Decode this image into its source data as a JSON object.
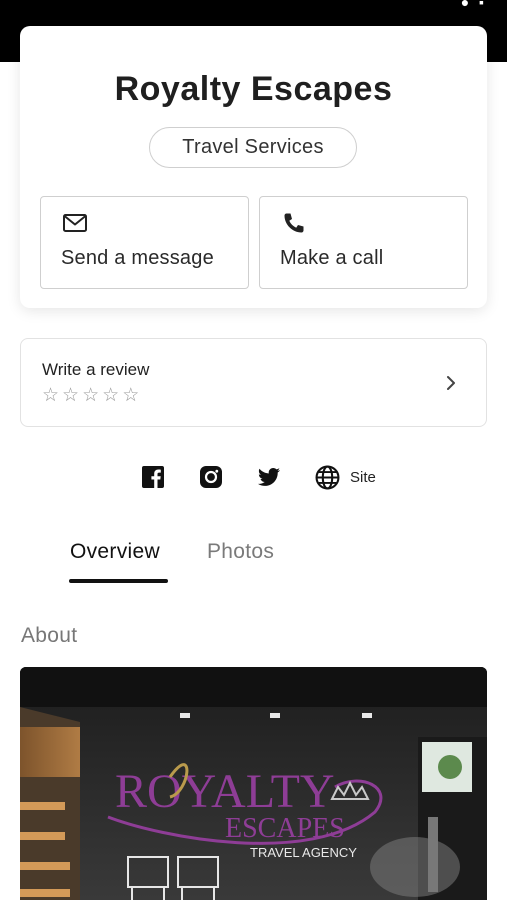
{
  "business": {
    "name": "Royalty Escapes",
    "category": "Travel Services"
  },
  "actions": {
    "message_label": "Send a message",
    "call_label": "Make a call"
  },
  "review": {
    "label": "Write a review",
    "stars": [
      "☆",
      "☆",
      "☆",
      "☆",
      "☆"
    ]
  },
  "social": {
    "site_label": "Site",
    "icons": [
      "facebook-icon",
      "instagram-icon",
      "twitter-icon",
      "globe-icon"
    ]
  },
  "tabs": {
    "overview": "Overview",
    "photos": "Photos",
    "active": "Overview"
  },
  "about": {
    "heading": "About",
    "image_logo_text": [
      "ROYALTY",
      "ESCAPES",
      "TRAVEL AGENCY"
    ]
  },
  "colors": {
    "logo_gold": "#b99a4c",
    "logo_purple": "#8e3d96",
    "tab_active": "#111111",
    "tab_inactive": "#7a7a7a"
  }
}
